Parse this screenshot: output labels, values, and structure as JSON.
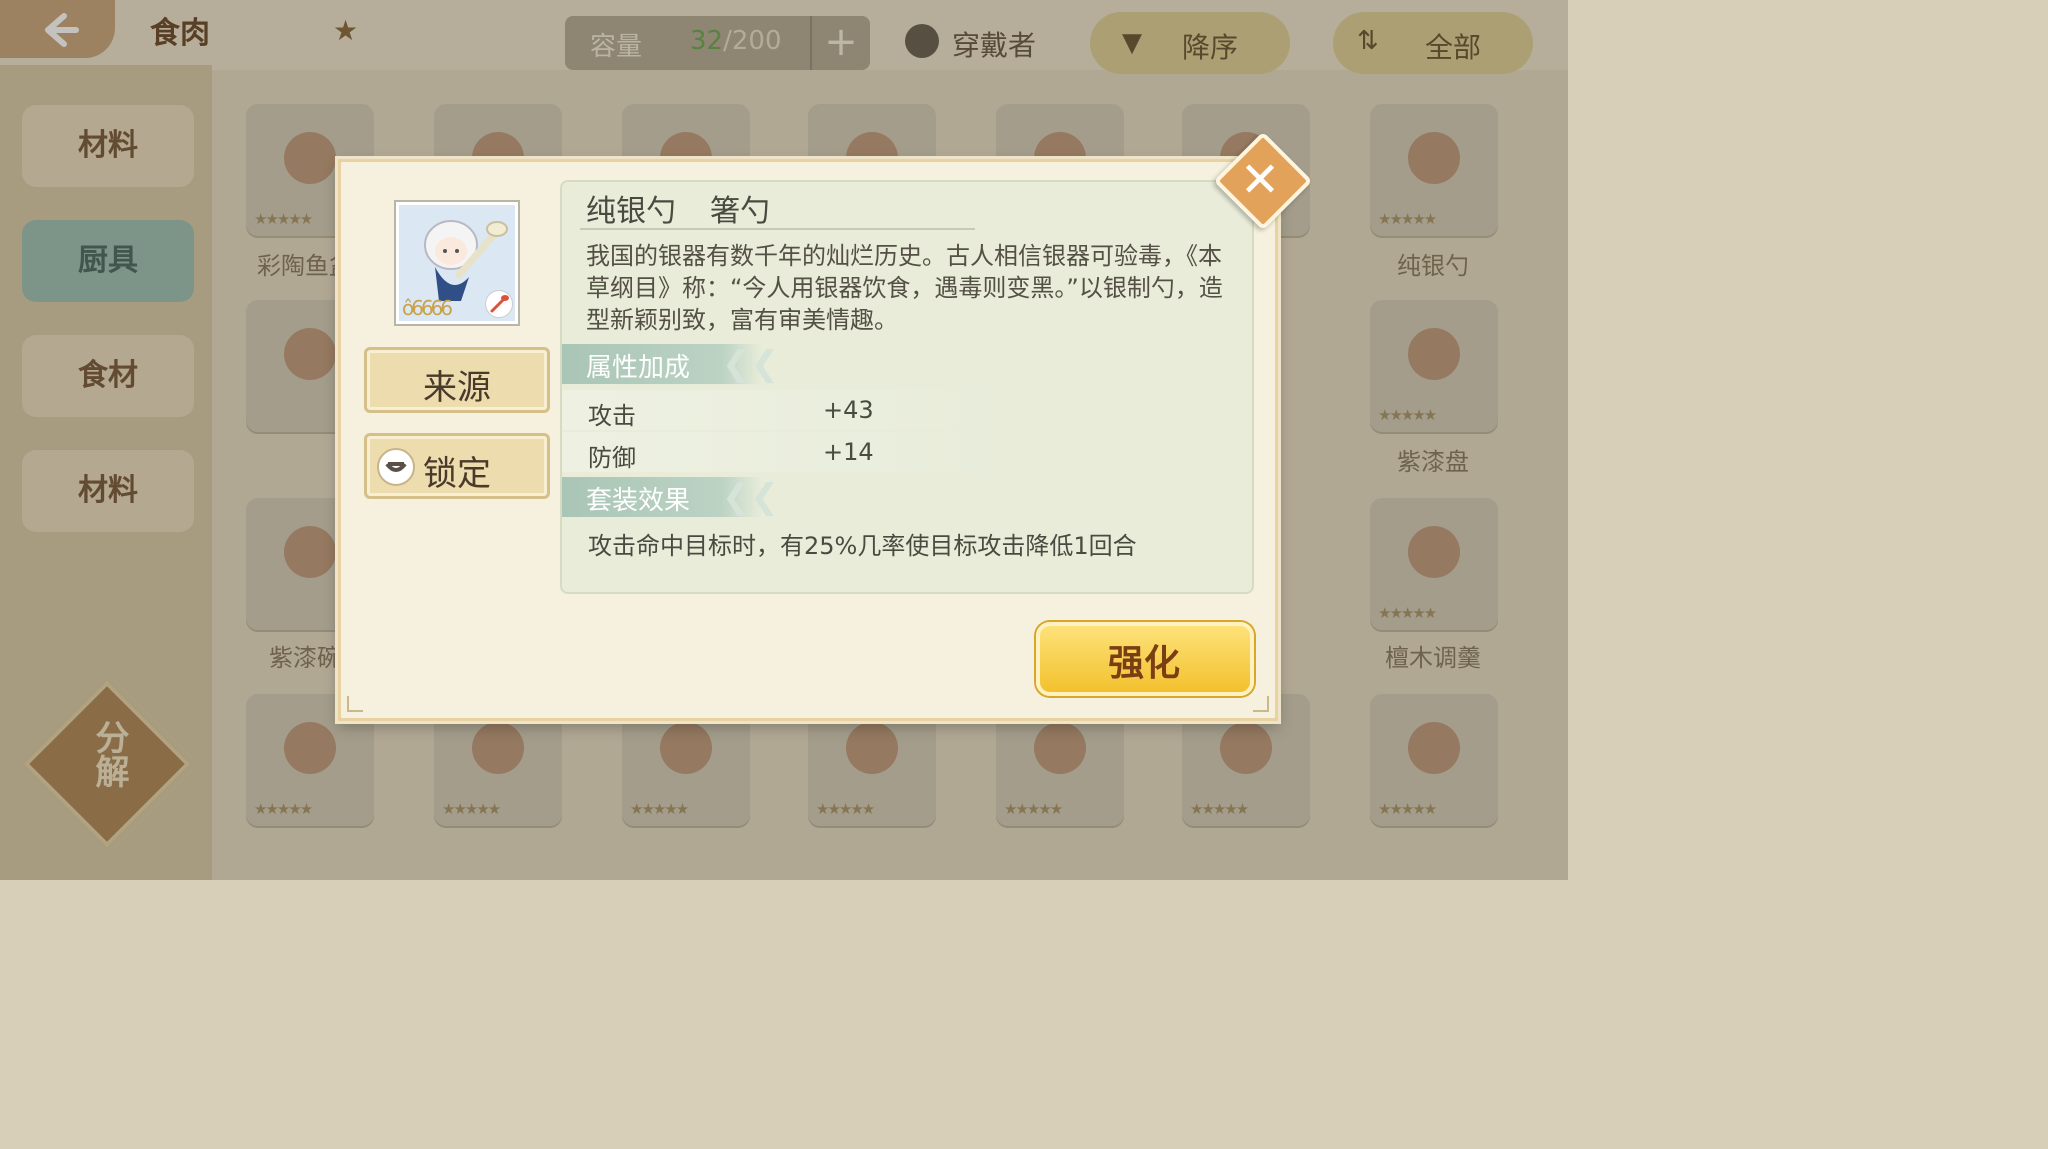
{
  "header": {
    "title": "食肉",
    "capacity_label": "容量",
    "capacity_current": "32",
    "capacity_total": "/200",
    "capacity_plus": "+",
    "wearer_label": "穿戴者",
    "sort_label": "降序",
    "sort_icon": "▼",
    "filter_label": "全部"
  },
  "sidebar": {
    "tabs": [
      {
        "label": "材料"
      },
      {
        "label": "厨具"
      },
      {
        "label": "食材"
      },
      {
        "label": "材料"
      }
    ],
    "divide_label": "分解"
  },
  "grid_names": [
    "彩陶鱼盆",
    "纯银勺",
    "紫漆盘",
    "紫漆碗",
    "檀木调羹"
  ],
  "dialog": {
    "item_name": "纯银勺",
    "item_type": "箸勺",
    "description": "我国的银器有数千年的灿烂历史。古人相信银器可验毒，《本草纲目》称：“今人用银器饮食，遇毒则变黑。”以银制勺，造型新颖别致，富有审美情趣。",
    "source_button": "来源",
    "lock_button": "锁定",
    "attributes_header": "属性加成",
    "stats": [
      {
        "name": "攻击",
        "value": "+43"
      },
      {
        "name": "防御",
        "value": "+14"
      }
    ],
    "set_header": "套装效果",
    "set_effect": "攻击命中目标时，有25%几率使目标攻击降低1回合",
    "enhance_button": "强化",
    "portrait_stars": "ô6666"
  }
}
